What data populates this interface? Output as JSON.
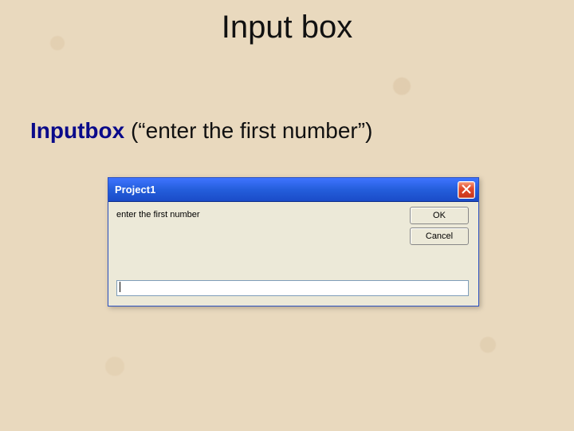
{
  "slide": {
    "title": "Input box",
    "code_fn": "Inputbox",
    "code_suffix": " (“enter the first number”)"
  },
  "dialog": {
    "title": "Project1",
    "prompt": "enter the first number",
    "ok_label": "OK",
    "cancel_label": "Cancel",
    "input_value": ""
  }
}
